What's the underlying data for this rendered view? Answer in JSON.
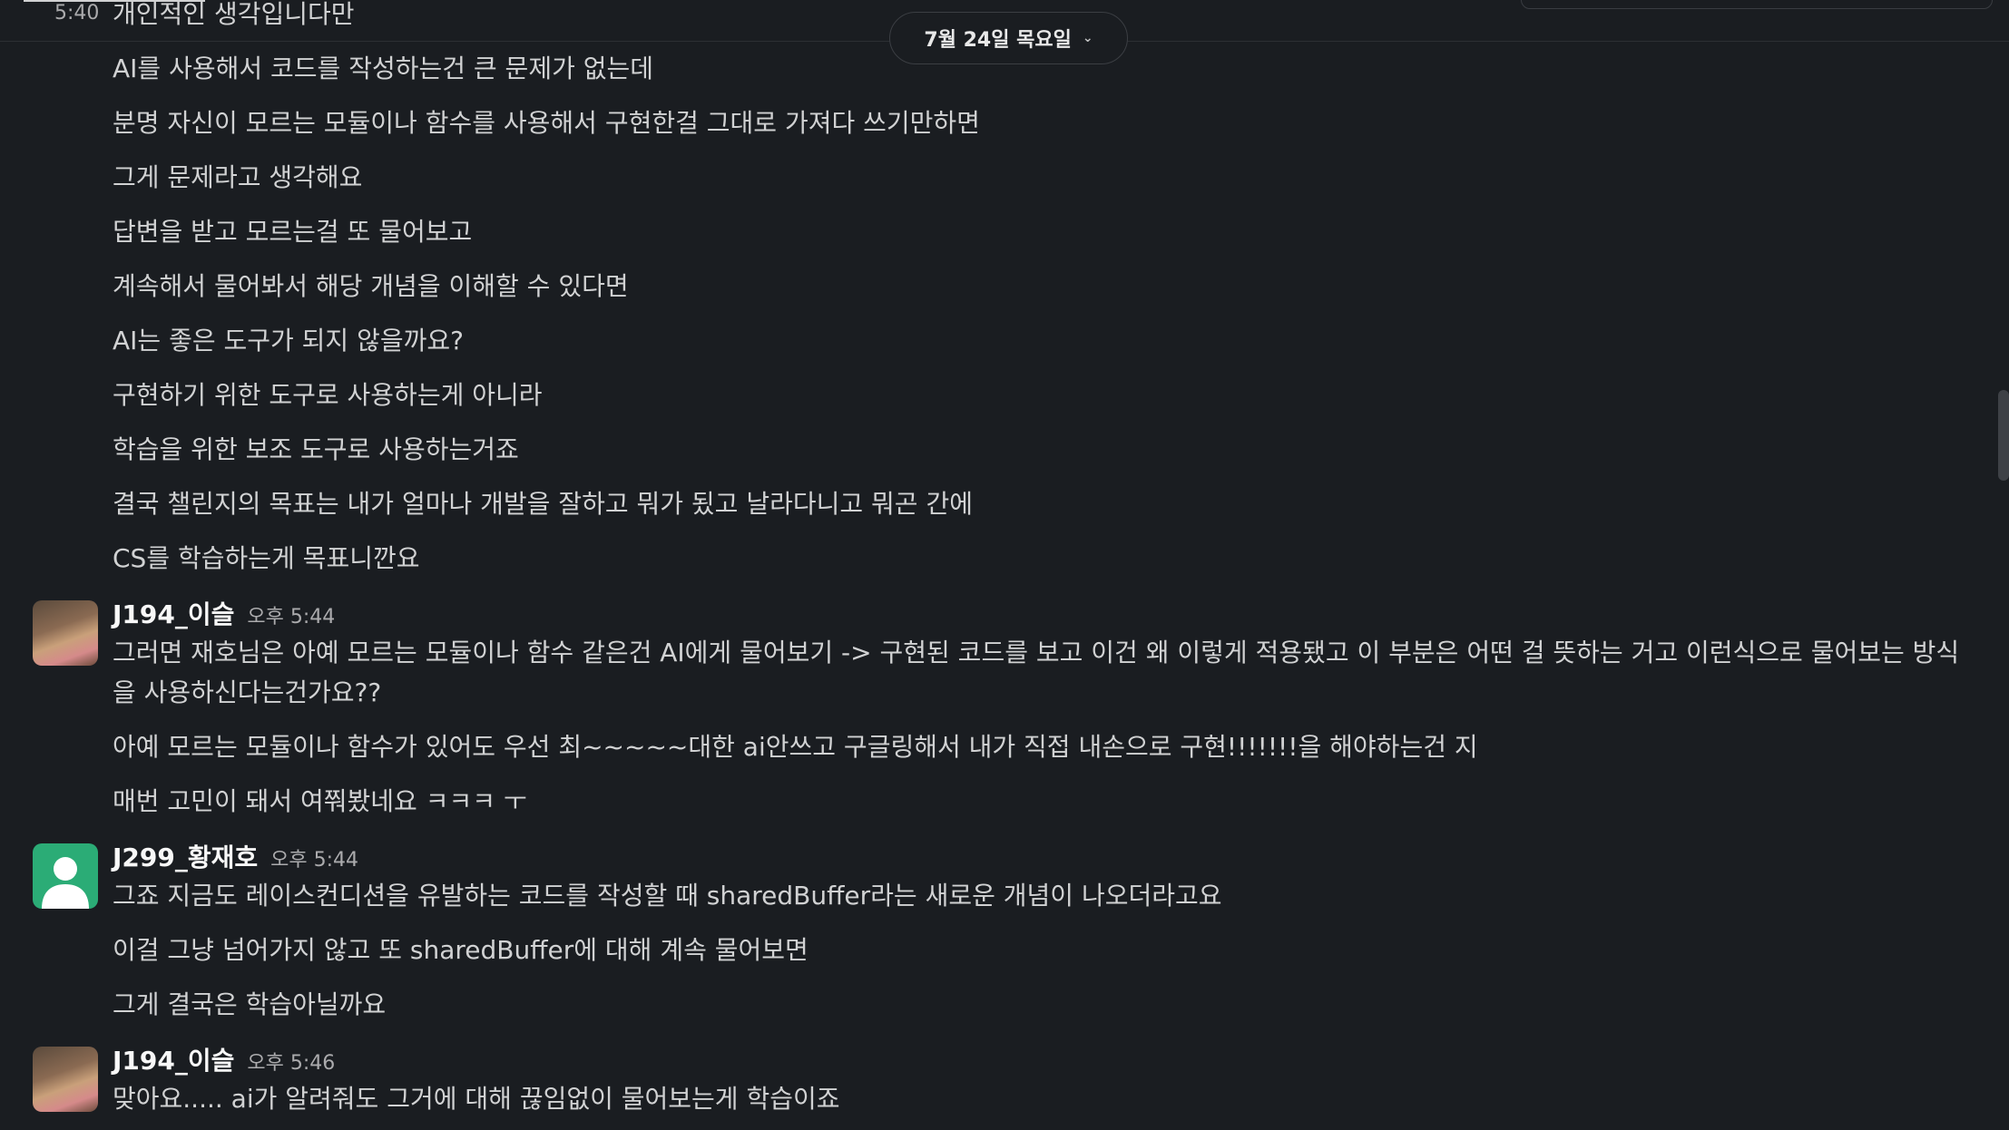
{
  "date_divider": {
    "label": "7월 24일 목요일"
  },
  "messages": {
    "first_time": "5:40",
    "first_text": "개인적인 생각입니다만",
    "block1": [
      "AI를 사용해서 코드를 작성하는건 큰 문제가 없는데",
      "분명 자신이 모르는 모듈이나 함수를 사용해서 구현한걸 그대로 가져다 쓰기만하면",
      "그게 문제라고 생각해요",
      "답변을 받고 모르는걸 또 물어보고",
      "계속해서 물어봐서 해당 개념을 이해할 수 있다면",
      "AI는 좋은 도구가 되지 않을까요?",
      "구현하기 위한 도구로 사용하는게 아니라",
      "학습을 위한 보조 도구로 사용하는거죠",
      "결국 챌린지의 목표는 내가 얼마나 개발을 잘하고 뭐가 됬고 날라다니고 뭐곤 간에",
      "CS를 학습하는게 목표니깐요"
    ],
    "post2": {
      "sender": "J194_이슬",
      "time": "오후 5:44",
      "lines": [
        "그러면 재호님은 아예 모르는 모듈이나 함수 같은건 AI에게 물어보기 -> 구현된 코드를 보고 이건 왜 이렇게 적용됐고 이 부분은 어떤 걸 뜻하는 거고 이런식으로 물어보는 방식을 사용하신다는건가요??",
        "아예 모르는 모듈이나 함수가 있어도 우선 최~~~~~대한 ai안쓰고 구글링해서 내가 직접 내손으로 구현!!!!!!!을 해야하는건 지",
        "매번 고민이 돼서 여쭤봤네요 ㅋㅋㅋ ㅜ"
      ]
    },
    "post3": {
      "sender": "J299_황재호",
      "time": "오후 5:44",
      "lines": [
        "그죠 지금도 레이스컨디션을 유발하는 코드를 작성할 때 sharedBuffer라는 새로운 개념이 나오더라고요",
        "이걸 그냥 넘어가지 않고 또 sharedBuffer에 대해 계속 물어보면",
        "그게 결국은 학습아닐까요"
      ]
    },
    "post4": {
      "sender": "J194_이슬",
      "time": "오후 5:46",
      "lines": [
        "맞아요..... ai가 알려줘도 그거에 대해 끊임없이 물어보는게 학습이죠"
      ]
    }
  },
  "colors": {
    "background": "#1a1d21",
    "text": "#d1d2d3",
    "sender": "#f8f8f8",
    "muted": "#ababad",
    "default_avatar": "#2bac76"
  }
}
